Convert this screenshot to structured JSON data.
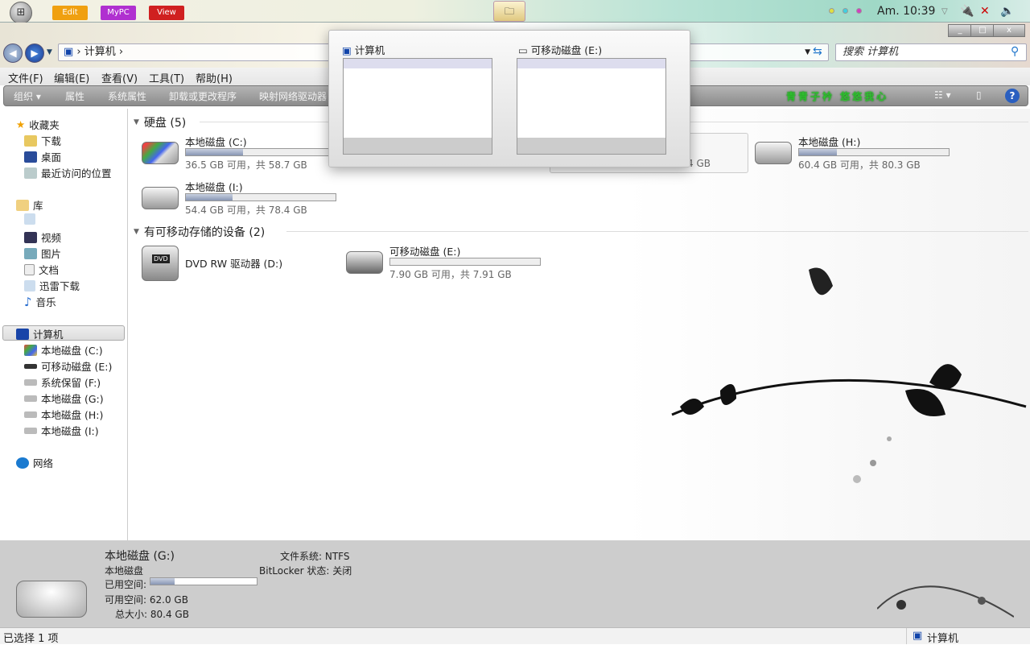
{
  "taskbar": {
    "tags": [
      {
        "label": "Edit",
        "color": "#f0a010"
      },
      {
        "label": "MyPC",
        "color": "#b030d0"
      },
      {
        "label": "View",
        "color": "#d02020"
      }
    ],
    "clock": "Am. 10:39",
    "tray_icons": [
      "power-icon",
      "network-disconnected-icon",
      "volume-icon"
    ],
    "dot_colors": [
      "#e0e040",
      "#40d0e0",
      "#d040c0"
    ]
  },
  "window": {
    "minimize": "_",
    "maximize": "□",
    "close": "x"
  },
  "address": {
    "path": [
      "计算机"
    ],
    "search_placeholder": "搜索 计算机"
  },
  "menu": [
    "文件(F)",
    "编辑(E)",
    "查看(V)",
    "工具(T)",
    "帮助(H)"
  ],
  "toolbar": {
    "items": [
      "组织",
      "属性",
      "系统属性",
      "卸载或更改程序",
      "映射网络驱动器"
    ],
    "slogan": "青青子衿  悠悠我心",
    "slogan_color": "#30c030"
  },
  "preview": {
    "windows": [
      {
        "title": "计算机"
      },
      {
        "title": "可移动磁盘 (E:)"
      }
    ]
  },
  "nav": {
    "favorites": {
      "label": "收藏夹",
      "items": [
        "下载",
        "桌面",
        "最近访问的位置"
      ]
    },
    "libraries": {
      "label": "库",
      "items": [
        "",
        "视频",
        "图片",
        "文档",
        "迅雷下载",
        "音乐"
      ]
    },
    "computer": {
      "label": "计算机",
      "items": [
        "本地磁盘 (C:)",
        "可移动磁盘 (E:)",
        "系统保留 (F:)",
        "本地磁盘 (G:)",
        "本地磁盘 (H:)",
        "本地磁盘 (I:)"
      ]
    },
    "network": {
      "label": "网络"
    }
  },
  "content": {
    "hard_disks": {
      "label": "硬盘 (5)",
      "drives": [
        {
          "name": "本地磁盘 (C:)",
          "info": "36.5 GB 可用，共 58.7 GB",
          "used_pct": 38
        },
        {
          "name": "",
          "info": "4 GB",
          "used_pct": 0
        },
        {
          "name": "本地磁盘 (H:)",
          "info": "60.4 GB 可用，共 80.3 GB",
          "used_pct": 25
        },
        {
          "name": "本地磁盘 (I:)",
          "info": "54.4 GB 可用，共 78.4 GB",
          "used_pct": 31
        }
      ]
    },
    "removable": {
      "label": "有可移动存储的设备 (2)",
      "drives": [
        {
          "name": "DVD RW 驱动器 (D:)"
        },
        {
          "name": "可移动磁盘 (E:)",
          "info": "7.90 GB 可用，共 7.91 GB",
          "used_pct": 0
        }
      ]
    }
  },
  "details": {
    "name": "本地磁盘 (G:)",
    "type": "本地磁盘",
    "used_label": "已用空间:",
    "used_pct": 23,
    "free_label": "可用空间:",
    "free": "62.0 GB",
    "total_label": "总大小:",
    "total": "80.4 GB",
    "fs_label": "文件系统:",
    "fs": "NTFS",
    "bitlocker_label": "BitLocker 状态:",
    "bitlocker": "关闭"
  },
  "status": {
    "selected": "已选择 1 项",
    "location": "计算机"
  }
}
